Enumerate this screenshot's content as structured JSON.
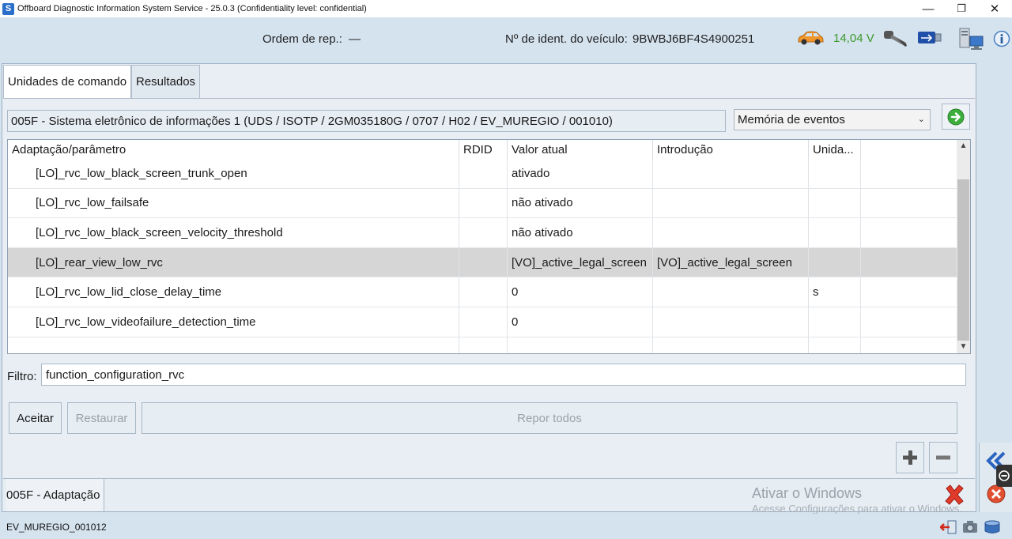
{
  "titlebar": {
    "title": "Offboard Diagnostic Information System Service - 25.0.3 (Confidentiality level: confidential)",
    "app_icon_letter": "S",
    "minimize": "—",
    "maximize": "❐",
    "close": "✕"
  },
  "header": {
    "repair_order_label": "Ordem de rep.:",
    "repair_order_value": "—",
    "vin_label": "Nº de ident. do veículo:",
    "vin_value": "9BWBJ6BF4S4900251",
    "voltage": "14,04 V"
  },
  "tabs": [
    {
      "label": "Unidades de comando",
      "active": true
    },
    {
      "label": "Resultados",
      "active": false
    }
  ],
  "ecu": {
    "description": "005F - Sistema eletrônico de informações 1  (UDS / ISOTP / 2GM035180G / 0707 / H02 / EV_MUREGIO / 001010)"
  },
  "mode_select": {
    "selected": "Memória de eventos"
  },
  "table": {
    "headers": [
      "Adaptação/parâmetro",
      "RDID",
      "Valor atual",
      "Introdução",
      "Unida...",
      ""
    ],
    "rows": [
      {
        "param": "[LO]_rvc_low_black_screen_trunk_open",
        "rdid": "",
        "current": "ativado",
        "input": "",
        "unit": ""
      },
      {
        "param": "[LO]_rvc_low_failsafe",
        "rdid": "",
        "current": "não ativado",
        "input": "",
        "unit": ""
      },
      {
        "param": "[LO]_rvc_low_black_screen_velocity_threshold",
        "rdid": "",
        "current": "não ativado",
        "input": "",
        "unit": ""
      },
      {
        "param": "[LO]_rear_view_low_rvc",
        "rdid": "",
        "current": "[VO]_active_legal_screen",
        "input": "[VO]_active_legal_screen",
        "unit": "",
        "selected": true
      },
      {
        "param": "[LO]_rvc_low_lid_close_delay_time",
        "rdid": "",
        "current": "0",
        "input": "",
        "unit": "s"
      },
      {
        "param": "[LO]_rvc_low_videofailure_detection_time",
        "rdid": "",
        "current": "0",
        "input": "",
        "unit": ""
      },
      {
        "param": "",
        "rdid": "",
        "current": "",
        "input": "",
        "unit": ""
      }
    ]
  },
  "filter": {
    "label": "Filtro:",
    "value": "function_configuration_rvc"
  },
  "buttons": {
    "accept": "Aceitar",
    "restore": "Restaurar",
    "reset_all": "Repor todos"
  },
  "bottom": {
    "adaptation_label": "005F - Adaptação",
    "watermark_title": "Ativar o Windows",
    "watermark_sub": "Acesse Configurações para ativar o Windows."
  },
  "statusbar": {
    "text": "EV_MUREGIO_001012"
  },
  "colors": {
    "background": "#d5e3ef",
    "voltage_green": "#3a9a2a",
    "selected_row": "#d6d6d6",
    "close_red": "#e03a2a",
    "go_green": "#3cae3c"
  }
}
